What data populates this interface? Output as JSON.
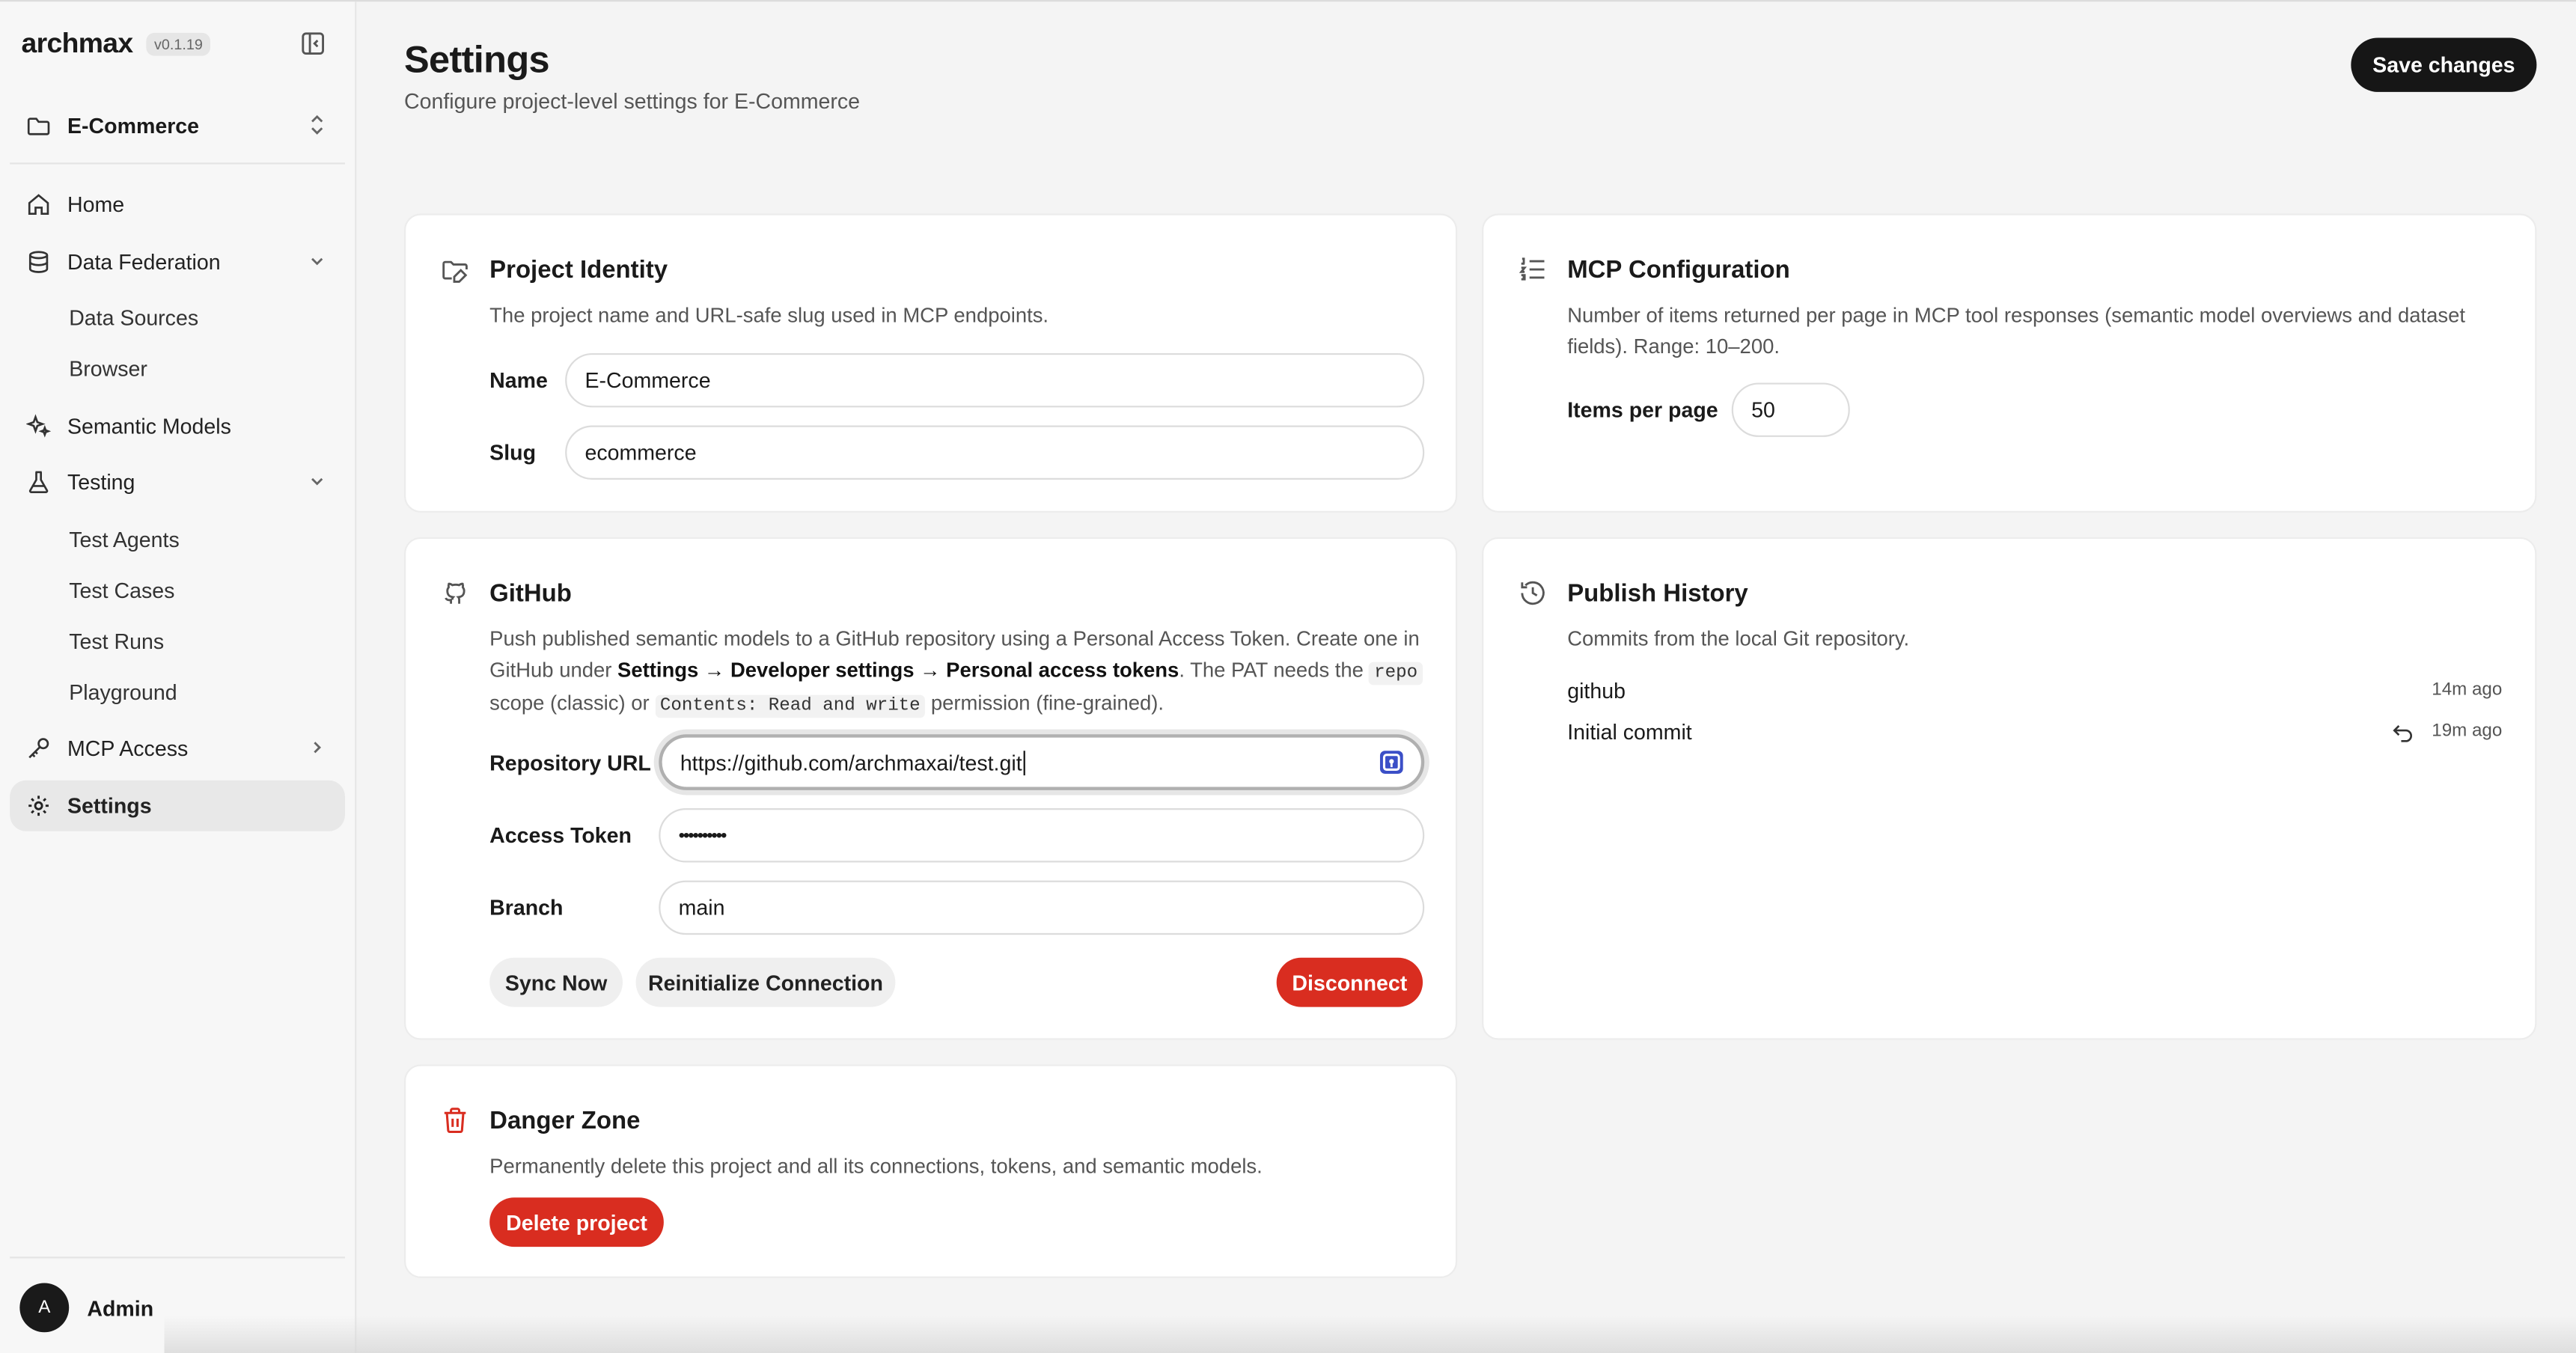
{
  "app": {
    "name": "archmax",
    "version": "v0.1.19"
  },
  "project_selector": {
    "label": "E-Commerce"
  },
  "sidebar": {
    "items": [
      {
        "label": "Home"
      },
      {
        "label": "Data Federation"
      },
      {
        "label": "Data Sources"
      },
      {
        "label": "Browser"
      },
      {
        "label": "Semantic Models"
      },
      {
        "label": "Testing"
      },
      {
        "label": "Test Agents"
      },
      {
        "label": "Test Cases"
      },
      {
        "label": "Test Runs"
      },
      {
        "label": "Playground"
      },
      {
        "label": "MCP Access"
      },
      {
        "label": "Settings"
      }
    ]
  },
  "user": {
    "initial": "A",
    "name": "Admin"
  },
  "header": {
    "title": "Settings",
    "subtitle": "Configure project-level settings for E-Commerce",
    "save_label": "Save changes"
  },
  "identity": {
    "title": "Project Identity",
    "desc": "The project name and URL-safe slug used in MCP endpoints.",
    "name_label": "Name",
    "name_value": "E-Commerce",
    "slug_label": "Slug",
    "slug_value": "ecommerce"
  },
  "mcp": {
    "title": "MCP Configuration",
    "desc": "Number of items returned per page in MCP tool responses (semantic model overviews and dataset fields). Range: 10–200.",
    "items_label": "Items per page",
    "items_value": "50"
  },
  "github": {
    "title": "GitHub",
    "desc_1": "Push published semantic models to a GitHub repository using a Personal Access Token. Create one in GitHub under ",
    "desc_path": "Settings → Developer settings → Personal access tokens",
    "desc_2": ". The PAT needs the ",
    "desc_code_1": "repo",
    "desc_3": " scope (classic) or ",
    "desc_code_2": "Contents: Read and write",
    "desc_4": " permission (fine-grained).",
    "repo_label": "Repository URL",
    "repo_value": "https://github.com/archmaxai/test.git",
    "token_label": "Access Token",
    "token_value": "••••••••••",
    "branch_label": "Branch",
    "branch_value": "main",
    "sync_label": "Sync Now",
    "reinit_label": "Reinitialize Connection",
    "disconnect_label": "Disconnect"
  },
  "publish": {
    "title": "Publish History",
    "desc": "Commits from the local Git repository.",
    "commits": [
      {
        "message": "github",
        "time": "14m ago"
      },
      {
        "message": "Initial commit",
        "time": "19m ago"
      }
    ]
  },
  "danger": {
    "title": "Danger Zone",
    "desc": "Permanently delete this project and all its connections, tokens, and semantic models.",
    "delete_label": "Delete project"
  },
  "colors": {
    "danger": "#d92d20",
    "primary": "#161616",
    "accent_icon": "#3b4fc7"
  }
}
